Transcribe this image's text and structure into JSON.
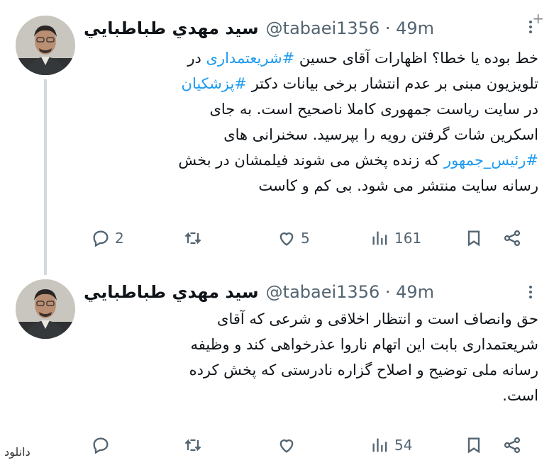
{
  "tweets": [
    {
      "author": {
        "name": "سيد مهدي طباطبايي",
        "handle": "@tabaei1356 · 49m"
      },
      "text": {
        "l1a": "خط بوده یا خطا؟ اظهارات آقای حسین ",
        "l1b": "#شریعتمداری",
        "l1c": " در",
        "l2a": "تلویزیون مبنی بر عدم انتشار برخی بیانات دکتر ",
        "l2b": "#پزشکیان",
        "l3": "در سایت ریاست جمهوری کاملا ناصحیح است. به جای",
        "l4": "اسکرین شات گرفتن رویه را بپرسید. سخنرانی های",
        "l5a": "#رئیس_جمهور",
        "l5b": " که زنده پخش می شوند فیلمشان در بخش",
        "l6": "رسانه سایت منتشر می شود. بی کم و کاست"
      },
      "actions": {
        "replies": "2",
        "retweets": "",
        "likes": "5",
        "views": "161"
      }
    },
    {
      "author": {
        "name": "سيد مهدي طباطبايي",
        "handle": "@tabaei1356 · 49m"
      },
      "text": {
        "l1": "حق وانصاف است و انتظار اخلاقی و شرعی که آقای",
        "l2": "شریعتمداری بابت این اتهام ناروا عذرخواهی کند و وظیفه",
        "l3": "رسانه ملی توضیح و اصلاح گزاره نادرستی که پخش کرده",
        "l4": "است."
      },
      "actions": {
        "replies": "",
        "retweets": "",
        "likes": "",
        "views": "54"
      }
    }
  ],
  "watermark": "دانلود",
  "colors": {
    "hashtag": "#1d9bf0",
    "secondary": "#536471",
    "text": "#0f1419"
  },
  "icons": [
    "reply-icon",
    "retweet-icon",
    "like-icon",
    "views-icon",
    "bookmark-icon",
    "share-icon",
    "more-icon"
  ]
}
